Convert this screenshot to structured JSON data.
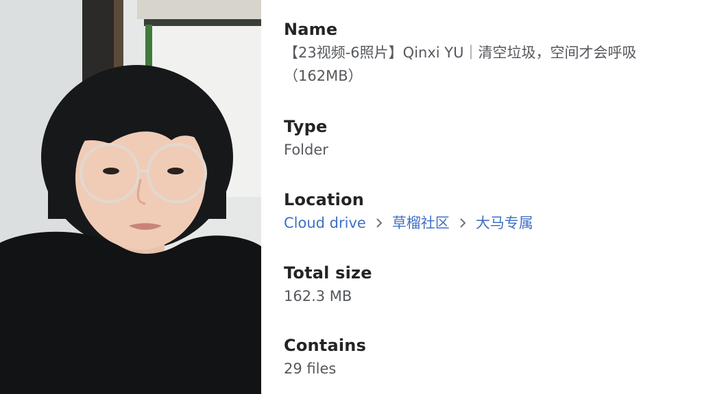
{
  "photo": {
    "icon": "person-photo",
    "colors": {
      "wall": "#e8eae8",
      "hair": "#17181a",
      "shirt": "#121314",
      "skin": "#f0ccb6"
    }
  },
  "details": {
    "name": {
      "label": "Name",
      "value": "【23视频-6照片】Qinxi YU｜清空垃圾，空间才会呼吸（162MB）"
    },
    "type": {
      "label": "Type",
      "value": "Folder"
    },
    "location": {
      "label": "Location",
      "path": [
        "Cloud drive",
        "草榴社区",
        "大马专属"
      ],
      "separator_icon": "chevron-right-icon",
      "link_color": "#3f6fc7"
    },
    "total_size": {
      "label": "Total size",
      "value": "162.3 MB"
    },
    "contains": {
      "label": "Contains",
      "value": "29 files"
    }
  }
}
